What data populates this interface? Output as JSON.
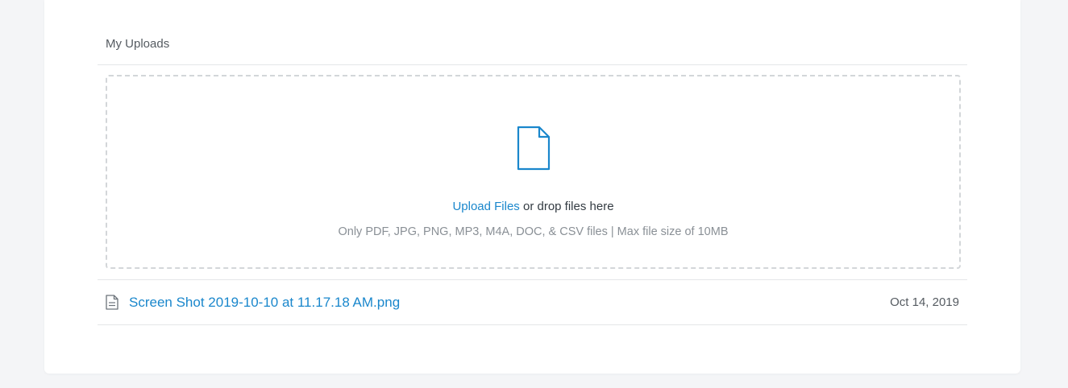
{
  "uploads": {
    "title": "My Uploads",
    "dropzone": {
      "icon": "file-icon",
      "link_label": "Upload Files",
      "instruction_suffix": " or drop files here",
      "restrictions": "Only PDF, JPG, PNG, MP3, M4A, DOC, & CSV files | Max file size of 10MB"
    },
    "files": [
      {
        "icon": "document-icon",
        "name": "Screen Shot 2019-10-10 at 11.17.18 AM.png",
        "date": "Oct 14, 2019"
      }
    ]
  },
  "colors": {
    "accent": "#1a87cc",
    "page_background": "#f4f5f7",
    "card_background": "#ffffff",
    "border": "#d3d6d9",
    "muted_text": "#8a9096"
  }
}
